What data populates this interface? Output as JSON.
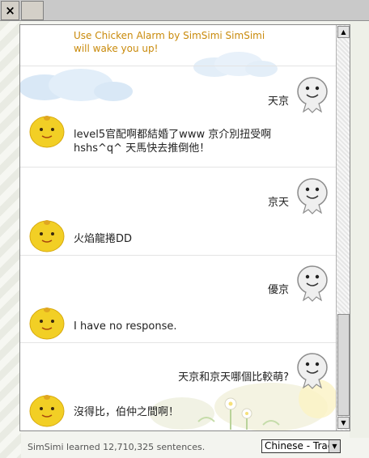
{
  "browser": {
    "close_tab_label": "×"
  },
  "chat": {
    "alarm_lines": [
      "Use Chicken Alarm by SimSimi SimSimi",
      "will wake you up!"
    ],
    "messages": [
      {
        "user": "天京",
        "bot": "level5官配啊都結婚了www 京介別扭受啊hshs^q^ 天馬快去推倒他！"
      },
      {
        "user": "京天",
        "bot": "火焰龍捲DD"
      },
      {
        "user": "優京",
        "bot": "I have no response."
      },
      {
        "user": "天京和京天哪個比較萌?",
        "bot": "沒得比，伯仲之間啊！"
      }
    ]
  },
  "scrollbar": {
    "up_arrow": "▲",
    "down_arrow": "▼"
  },
  "footer": {
    "sentences_text": "SimSimi learned 12,710,325 sentences.",
    "language_select": "Chinese - Traditional",
    "select_arrow": "▼"
  },
  "colors": {
    "alarm_text": "#c98a0b",
    "chick_yellow": "#f2cf25"
  },
  "icons": {
    "user_avatar": "simsimi-grey-avatar-icon",
    "bot_avatar": "yellow-chick-avatar-icon"
  }
}
